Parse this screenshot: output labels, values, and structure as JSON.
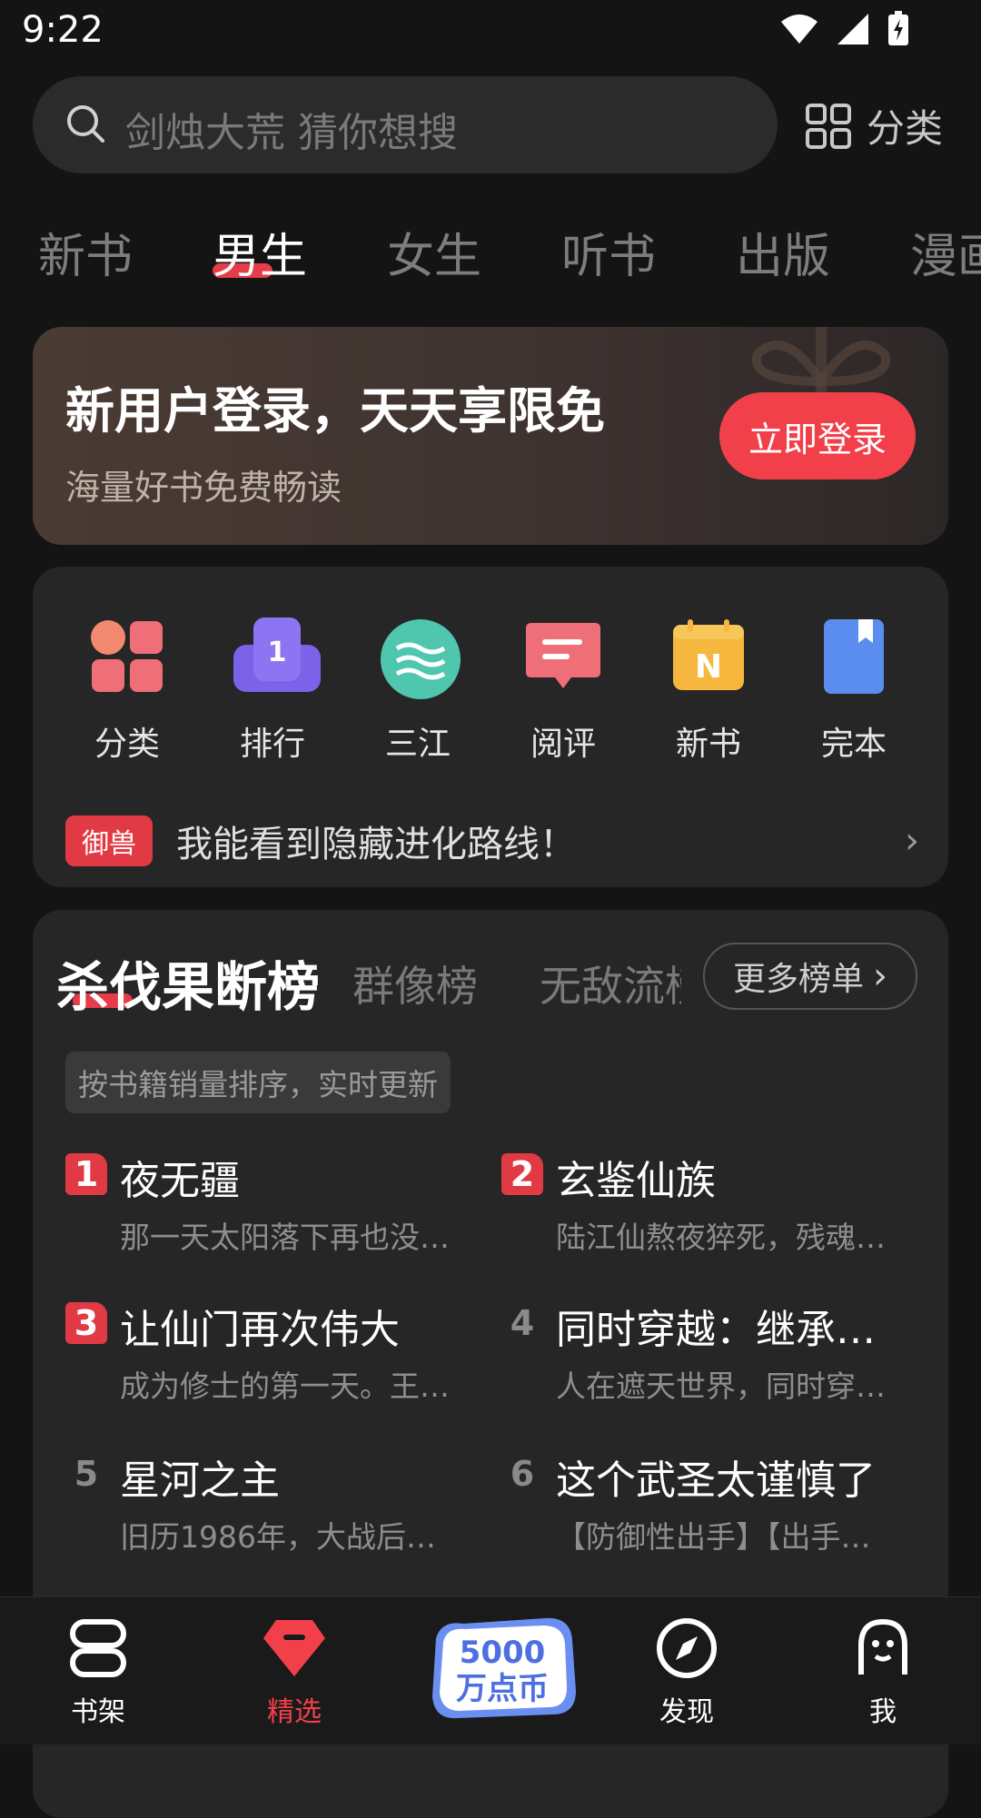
{
  "status": {
    "time": "9:22"
  },
  "search": {
    "placeholder": "剑烛大荒 猜你想搜",
    "category_label": "分类"
  },
  "tabs": [
    "新书",
    "男生",
    "女生",
    "听书",
    "出版",
    "漫画"
  ],
  "banner": {
    "title": "新用户登录，天天享限免",
    "subtitle": "海量好书免费畅读",
    "button": "立即登录"
  },
  "quick_nav": [
    {
      "label": "分类",
      "icon": "grid-icon"
    },
    {
      "label": "排行",
      "icon": "rank-icon"
    },
    {
      "label": "三江",
      "icon": "river-icon"
    },
    {
      "label": "阅评",
      "icon": "comment-icon"
    },
    {
      "label": "新书",
      "icon": "new-book-icon"
    },
    {
      "label": "完本",
      "icon": "bookmark-book-icon"
    }
  ],
  "promo": {
    "badge": "御兽",
    "text": "我能看到隐藏进化路线！"
  },
  "ranking": {
    "tabs": [
      "杀伐果断榜",
      "群像榜",
      "无敌流榜"
    ],
    "more": "更多榜单",
    "hint": "按书籍销量排序，实时更新",
    "books": [
      {
        "rank": "1",
        "title": "夜无疆",
        "desc": "那一天太阳落下再也没…"
      },
      {
        "rank": "2",
        "title": "玄鉴仙族",
        "desc": "陆江仙熬夜猝死，残魂…"
      },
      {
        "rank": "3",
        "title": "让仙门再次伟大",
        "desc": "成为修士的第一天。王…"
      },
      {
        "rank": "4",
        "title": "同时穿越：继承…",
        "desc": "人在遮天世界，同时穿…"
      },
      {
        "rank": "5",
        "title": "星河之主",
        "desc": "旧历1986年，大战后…"
      },
      {
        "rank": "6",
        "title": "这个武圣太谨慎了",
        "desc": "【防御性出手】【出手…"
      }
    ]
  },
  "bottom_nav": {
    "bookshelf": "书架",
    "featured": "精选",
    "promo_badge": "5000万点币",
    "discover": "发现",
    "me": "我"
  },
  "colors": {
    "accent": "#f2404a",
    "background": "#141414",
    "card": "#262626"
  }
}
